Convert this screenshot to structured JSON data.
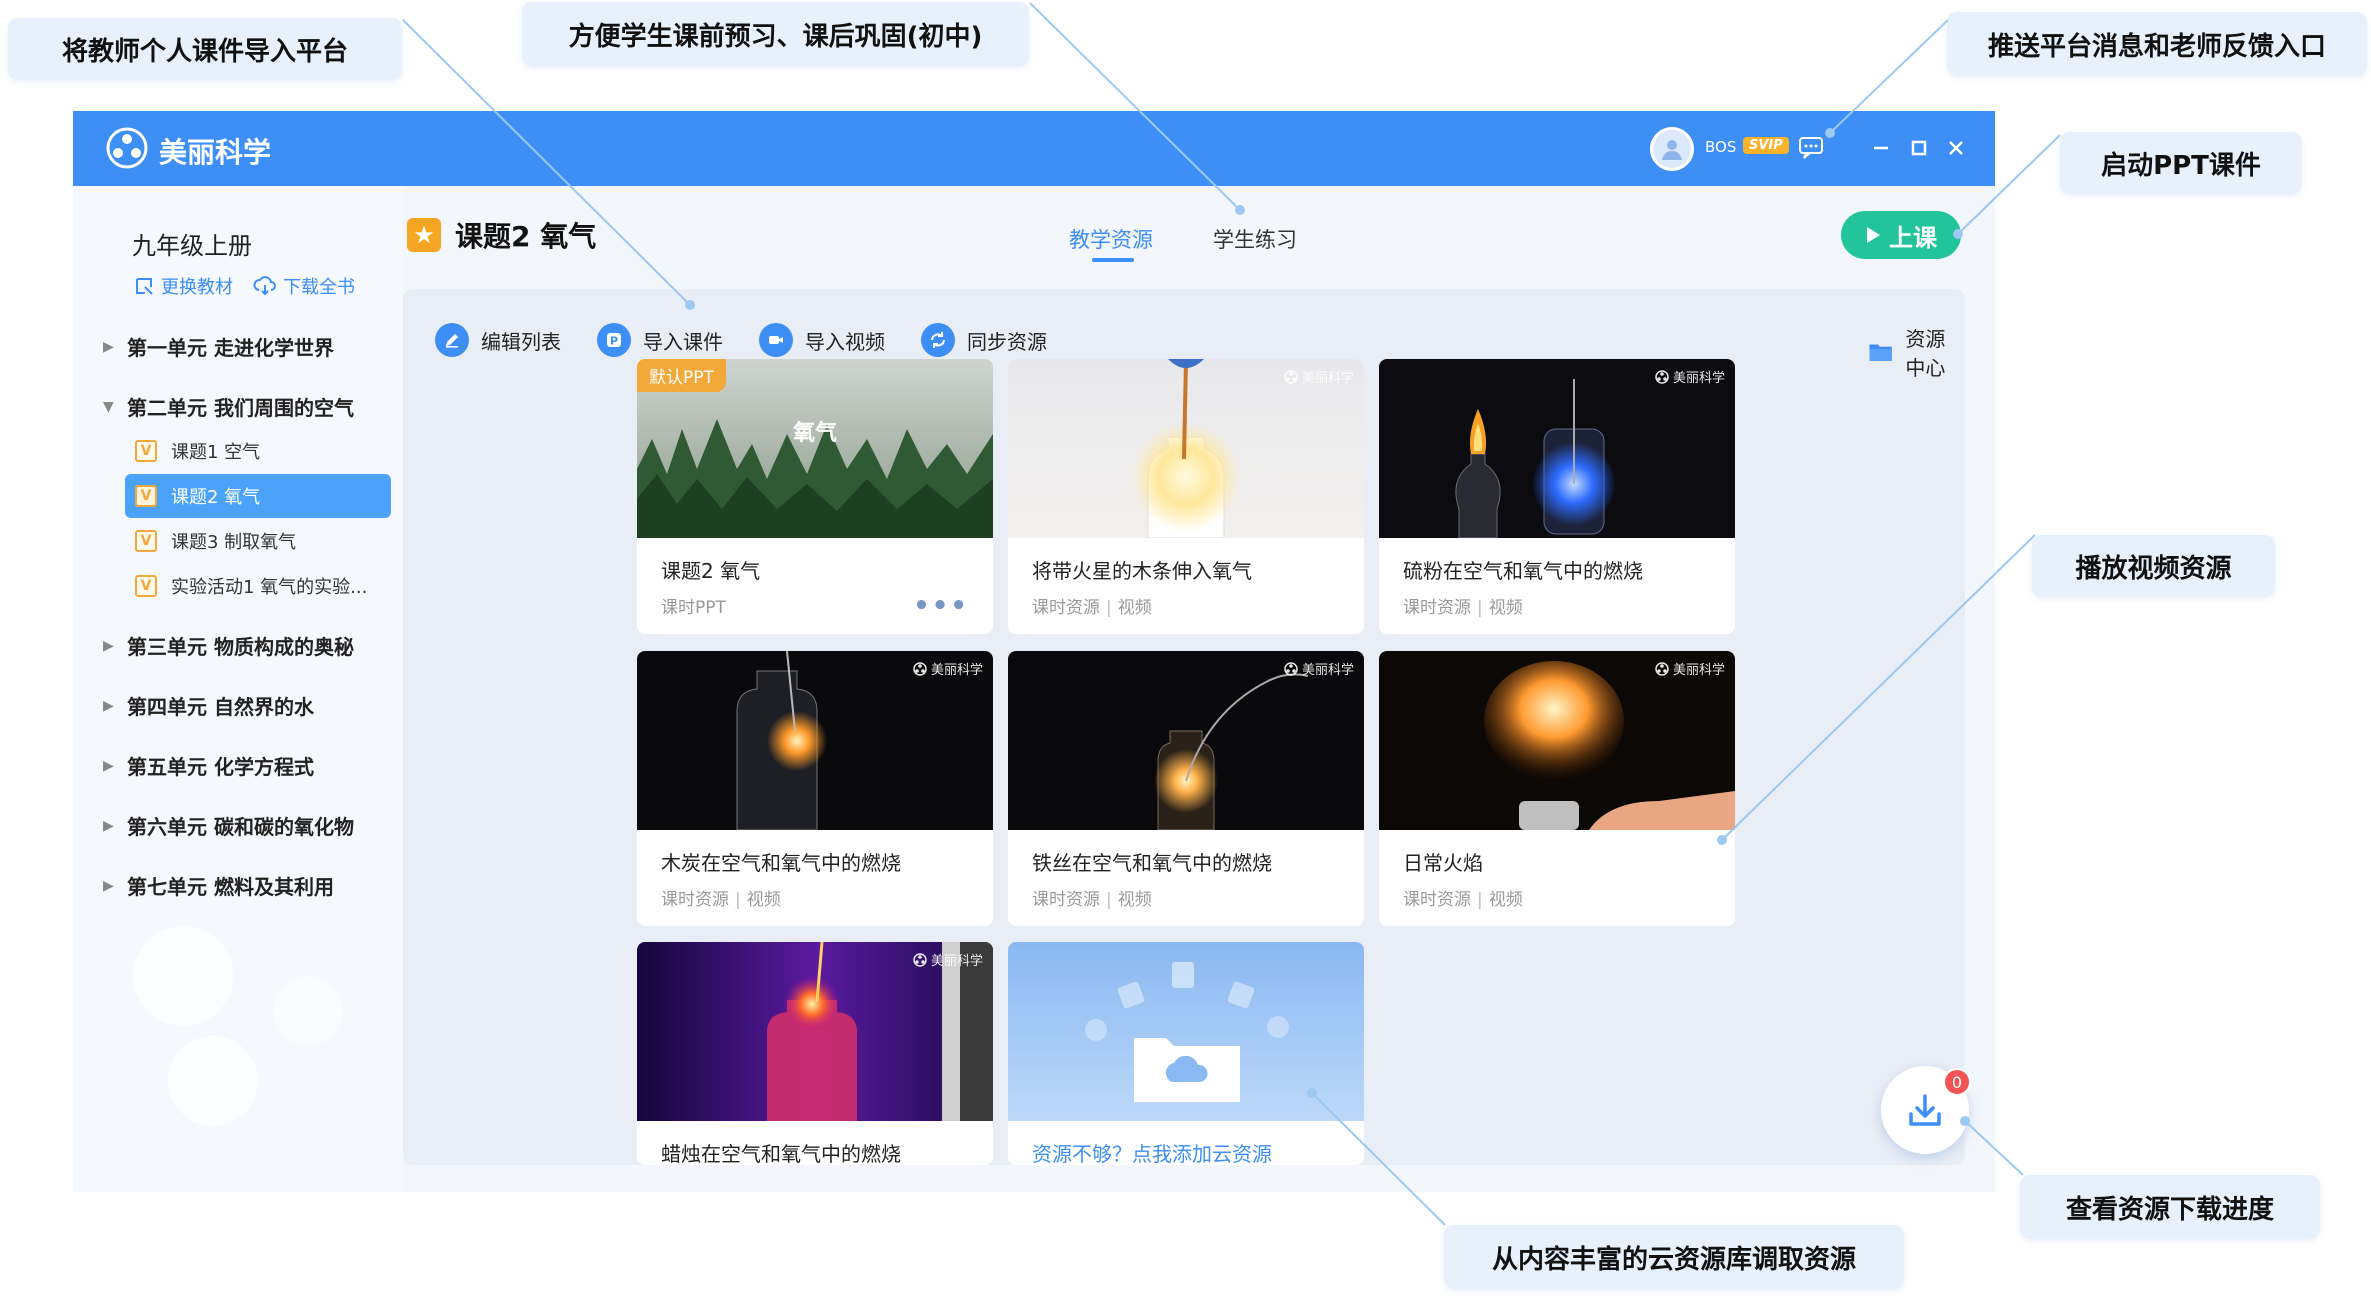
{
  "callouts": {
    "import_platform": "将教师个人课件导入平台",
    "preview_review": "方便学生课前预习、课后巩固(初中)",
    "messages_feedback": "推送平台消息和老师反馈入口",
    "start_ppt": "启动PPT课件",
    "play_video": "播放视频资源",
    "cloud_library": "从内容丰富的云资源库调取资源",
    "download_progress": "查看资源下载进度"
  },
  "titlebar": {
    "app_name": "美丽科学",
    "user_name": "BOS",
    "vip_badge": "SVIP"
  },
  "sidebar": {
    "grade": "九年级上册",
    "change_textbook": "更换教材",
    "download_book": "下载全书",
    "units": [
      {
        "label": "第一单元 走进化学世界",
        "expanded": false
      },
      {
        "label": "第二单元 我们周围的空气",
        "expanded": true
      },
      {
        "label": "第三单元 物质构成的奥秘",
        "expanded": false
      },
      {
        "label": "第四单元 自然界的水",
        "expanded": false
      },
      {
        "label": "第五单元 化学方程式",
        "expanded": false
      },
      {
        "label": "第六单元 碳和碳的氧化物",
        "expanded": false
      },
      {
        "label": "第七单元 燃料及其利用",
        "expanded": false
      }
    ],
    "lessons": [
      {
        "badge": "V",
        "label": "课题1 空气"
      },
      {
        "badge": "V",
        "label": "课题2 氧气"
      },
      {
        "badge": "V",
        "label": "课题3 制取氧气"
      },
      {
        "badge": "V",
        "label": "实验活动1 氧气的实验..."
      }
    ]
  },
  "header": {
    "lesson_title": "课题2 氧气",
    "tabs": [
      {
        "label": "教学资源",
        "active": true
      },
      {
        "label": "学生练习",
        "active": false
      }
    ],
    "start_button": "上课"
  },
  "toolbar": {
    "edit_list": "编辑列表",
    "import_courseware": "导入课件",
    "import_video": "导入视频",
    "sync_resources": "同步资源",
    "resource_center": "资源中心"
  },
  "cards": [
    {
      "title": "课题2 氧气",
      "meta_a": "课时PPT",
      "meta_b": "",
      "badge": "默认PPT",
      "thumb_text": "氧气",
      "watermark": ""
    },
    {
      "title": "将带火星的木条伸入氧气",
      "meta_a": "课时资源",
      "meta_b": "视频",
      "badge": "",
      "thumb_text": "",
      "watermark": "美丽科学"
    },
    {
      "title": "硫粉在空气和氧气中的燃烧",
      "meta_a": "课时资源",
      "meta_b": "视频",
      "badge": "",
      "thumb_text": "",
      "watermark": "美丽科学"
    },
    {
      "title": "木炭在空气和氧气中的燃烧",
      "meta_a": "课时资源",
      "meta_b": "视频",
      "badge": "",
      "thumb_text": "",
      "watermark": "美丽科学"
    },
    {
      "title": "铁丝在空气和氧气中的燃烧",
      "meta_a": "课时资源",
      "meta_b": "视频",
      "badge": "",
      "thumb_text": "",
      "watermark": "美丽科学"
    },
    {
      "title": "日常火焰",
      "meta_a": "课时资源",
      "meta_b": "视频",
      "badge": "",
      "thumb_text": "",
      "watermark": "美丽科学"
    },
    {
      "title": "蜡烛在空气和氧气中的燃烧",
      "meta_a": "",
      "meta_b": "",
      "badge": "",
      "thumb_text": "",
      "watermark": "美丽科学"
    }
  ],
  "add_cloud": {
    "label": "资源不够？点我添加云资源"
  },
  "download": {
    "count": "0"
  },
  "colors": {
    "brand_blue": "#3d8ef5",
    "start_green": "#22c49c",
    "badge_orange": "#f3a83a",
    "callout_bg": "#e6f1fc"
  }
}
